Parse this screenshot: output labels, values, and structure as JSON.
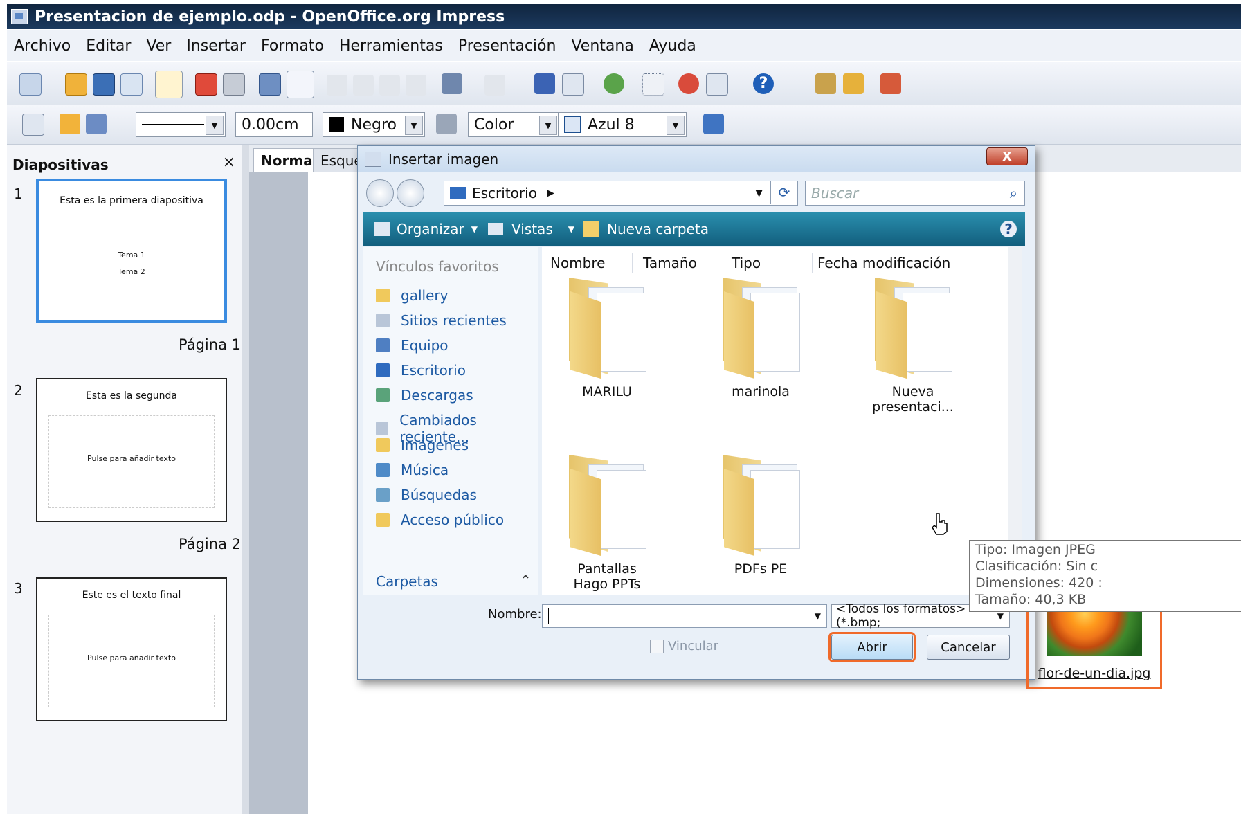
{
  "window": {
    "title": "Presentacion de ejemplo.odp - OpenOffice.org Impress"
  },
  "menu": [
    "Archivo",
    "Editar",
    "Ver",
    "Insertar",
    "Formato",
    "Herramientas",
    "Presentación",
    "Ventana",
    "Ayuda"
  ],
  "toolbar2": {
    "line_width": "0.00cm",
    "line_color": "Negro",
    "fill_type": "Color",
    "fill_color": "Azul 8"
  },
  "slides_panel": {
    "title": "Diapositivas",
    "close_glyph": "×",
    "slides": [
      {
        "number": "1",
        "title": "Esta es la primera diapositiva",
        "line1": "Tema 1",
        "line2": "Tema 2",
        "page_label": "Página 1"
      },
      {
        "number": "2",
        "title": "Esta es la segunda",
        "placeholder": "Pulse para añadir texto",
        "page_label": "Página 2"
      },
      {
        "number": "3",
        "title": "Este es el texto final",
        "placeholder": "Pulse para añadir texto"
      }
    ]
  },
  "view_tabs": [
    "Normal",
    "Esque"
  ],
  "dialog": {
    "title": "Insertar imagen",
    "close_glyph": "X",
    "address": "Escritorio",
    "search_placeholder": "Buscar",
    "commands": {
      "organize": "Organizar",
      "views": "Vistas",
      "new_folder": "Nueva carpeta"
    },
    "favorites_header": "Vínculos favoritos",
    "favorites": [
      "gallery",
      "Sitios recientes",
      "Equipo",
      "Escritorio",
      "Descargas",
      "Cambiados reciente...",
      "Imágenes",
      "Música",
      "Búsquedas",
      "Acceso público"
    ],
    "folders_label": "Carpetas",
    "columns": [
      "Nombre",
      "Tamaño",
      "Tipo",
      "Fecha modificación"
    ],
    "items": [
      {
        "name": "MARILU"
      },
      {
        "name": "marinola"
      },
      {
        "name": "Nueva presentaci..."
      },
      {
        "name": "Pantallas Hago PPTs"
      },
      {
        "name": "PDFs PE"
      },
      {
        "name": "flor-de-un-dia.jpg"
      }
    ],
    "filename_label": "Nombre:",
    "filename_value": "",
    "filetype": "<Todos los formatos> (*.bmp;",
    "link_label": "Vincular",
    "open_button": "Abrir",
    "cancel_button": "Cancelar"
  },
  "tooltip": {
    "line1": "Tipo: Imagen JPEG",
    "line2": "Clasificación: Sin c",
    "line3": "Dimensiones: 420 :",
    "line4": "Tamaño: 40,3 KB"
  },
  "colors": {
    "highlight": "#f06a2a",
    "slide_selected": "#3a8be0",
    "link_blue": "#1d5aa3"
  }
}
